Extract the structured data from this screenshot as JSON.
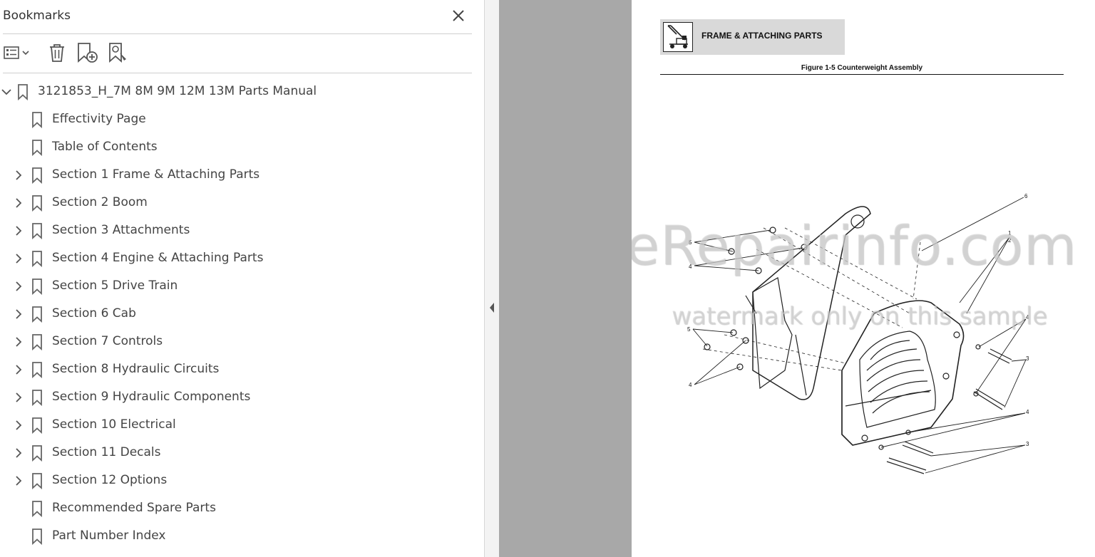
{
  "panel": {
    "title": "Bookmarks",
    "close_icon": "close-icon"
  },
  "toolbar": {
    "options_icon": "list-options-icon",
    "delete_icon": "trash-icon",
    "new_bookmark_icon": "add-bookmark-icon",
    "bookmark_search_icon": "bookmark-search-icon"
  },
  "tree": {
    "root": {
      "label": "3121853_H_7M 8M 9M 12M 13M Parts Manual",
      "expanded": true
    },
    "items": [
      {
        "label": "Effectivity Page",
        "expandable": false
      },
      {
        "label": "Table of Contents",
        "expandable": false
      },
      {
        "label": "Section 1 Frame & Attaching Parts",
        "expandable": true
      },
      {
        "label": "Section 2 Boom",
        "expandable": true
      },
      {
        "label": "Section 3 Attachments",
        "expandable": true
      },
      {
        "label": "Section 4 Engine & Attaching Parts",
        "expandable": true
      },
      {
        "label": "Section 5 Drive Train",
        "expandable": true
      },
      {
        "label": "Section 6 Cab",
        "expandable": true
      },
      {
        "label": "Section 7 Controls",
        "expandable": true
      },
      {
        "label": "Section 8 Hydraulic Circuits",
        "expandable": true
      },
      {
        "label": "Section 9 Hydraulic Components",
        "expandable": true
      },
      {
        "label": "Section 10 Electrical",
        "expandable": true
      },
      {
        "label": "Section 11 Decals",
        "expandable": true
      },
      {
        "label": "Section 12 Options",
        "expandable": true
      },
      {
        "label": "Recommended Spare Parts",
        "expandable": false
      },
      {
        "label": "Part Number Index",
        "expandable": false
      }
    ]
  },
  "document": {
    "section_tab": "FRAME & ATTACHING PARTS",
    "figure_title": "Figure 1-5 Counterweight Assembly",
    "callouts": [
      "6",
      "1",
      "2",
      "5",
      "4",
      "5",
      "4",
      "4",
      "3",
      "4",
      "3"
    ],
    "watermark_main": "eRepairinfo.com",
    "watermark_sub": "watermark only on this sample"
  },
  "colors": {
    "panel_bg": "#ffffff",
    "gutter": "#a8a8a8",
    "text": "#444444",
    "icon": "#555555"
  }
}
